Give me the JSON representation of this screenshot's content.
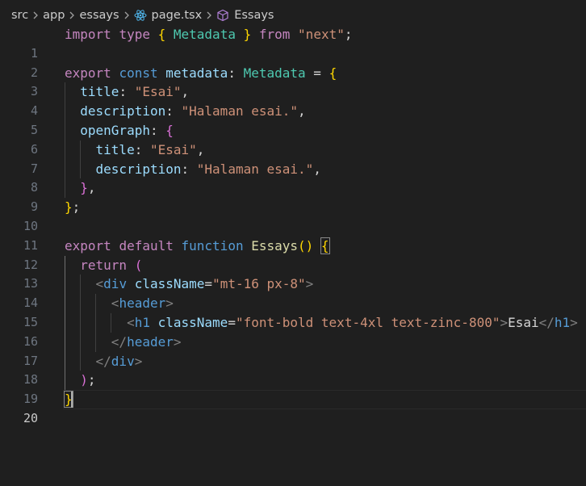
{
  "breadcrumb": {
    "items": [
      "src",
      "app",
      "essays",
      "page.tsx",
      "Essays"
    ],
    "icons": [
      "chevron-right-icon",
      "react-file-icon",
      "symbol-cube-icon"
    ]
  },
  "editor": {
    "active_line": "20",
    "line_numbers": [
      "1",
      "2",
      "3",
      "4",
      "5",
      "6",
      "7",
      "8",
      "9",
      "10",
      "11",
      "12",
      "13",
      "14",
      "15",
      "16",
      "17",
      "18",
      "19",
      "20"
    ],
    "code": {
      "l1": [
        "import",
        "type",
        "{",
        "Metadata",
        "}",
        "from",
        "\"next\"",
        ";"
      ],
      "l3": [
        "export",
        "const",
        "metadata",
        ":",
        "Metadata",
        "=",
        "{"
      ],
      "l4": [
        "title",
        ":",
        "\"Esai\"",
        ","
      ],
      "l5": [
        "description",
        ":",
        "\"Halaman esai.\"",
        ","
      ],
      "l6": [
        "openGraph",
        ":",
        "{"
      ],
      "l7": [
        "title",
        ":",
        "\"Esai\"",
        ","
      ],
      "l8": [
        "description",
        ":",
        "\"Halaman esai.\"",
        ","
      ],
      "l9": [
        "}",
        ","
      ],
      "l10": [
        "}",
        ";"
      ],
      "l12": [
        "export",
        "default",
        "function",
        "Essays",
        "()",
        "{"
      ],
      "l13": [
        "return",
        "("
      ],
      "l14": [
        "<",
        "div",
        "className",
        "=",
        "\"mt-16 px-8\"",
        ">"
      ],
      "l15": [
        "<",
        "header",
        ">"
      ],
      "l16": [
        "<",
        "h1",
        "className",
        "=",
        "\"font-bold text-4xl text-zinc-800\"",
        ">",
        "Esai",
        "</",
        "h1",
        ">"
      ],
      "l17": [
        "</",
        "header",
        ">"
      ],
      "l18": [
        "</",
        "div",
        ">"
      ],
      "l19": [
        ")",
        ";"
      ],
      "l20": [
        "}"
      ]
    }
  },
  "colors": {
    "background": "#1f1f1f",
    "keyword_control": "#c586c0",
    "keyword_storage": "#569cd6",
    "type": "#4ec9b0",
    "variable": "#9cdcfe",
    "function": "#dcdcaa",
    "string": "#ce9178",
    "bracket_level1": "#ffd700",
    "bracket_level2": "#da70d6",
    "bracket_level3": "#179fff"
  }
}
